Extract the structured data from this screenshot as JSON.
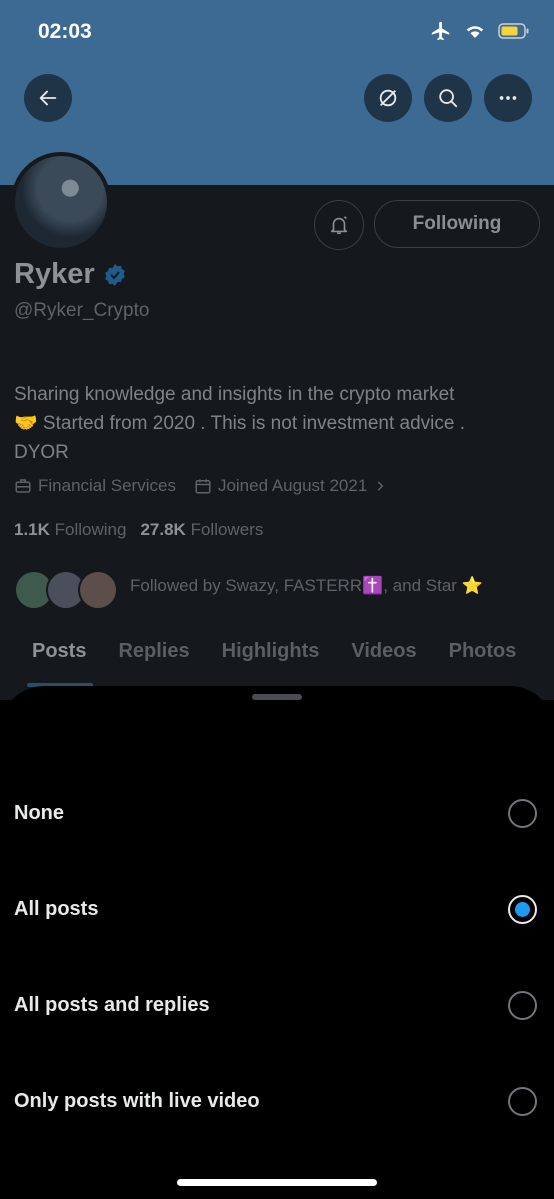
{
  "status_bar": {
    "time": "02:03"
  },
  "profile": {
    "name": "Ryker",
    "handle": "@Ryker_Crypto",
    "follow_button": "Following",
    "bio_line1": "Sharing knowledge and insights in the crypto market",
    "bio_line2": "🤝 Started from 2020 . This is not investment advice .",
    "bio_line3": "DYOR",
    "category": "Financial Services",
    "joined": "Joined August 2021",
    "following_count": "1.1K",
    "following_label": "Following",
    "followers_count": "27.8K",
    "followers_label": "Followers",
    "followed_by": "Followed by Swazy, FASTERR✝️, and Star ⭐"
  },
  "tabs": [
    "Posts",
    "Replies",
    "Highlights",
    "Videos",
    "Photos"
  ],
  "sheet": {
    "options": [
      {
        "label": "None",
        "selected": false
      },
      {
        "label": "All posts",
        "selected": true
      },
      {
        "label": "All posts and replies",
        "selected": false
      },
      {
        "label": "Only posts with live video",
        "selected": false
      }
    ]
  },
  "colors": {
    "banner": "#3d6a92",
    "accent": "#1d9bf0",
    "sheet": "#000000"
  }
}
